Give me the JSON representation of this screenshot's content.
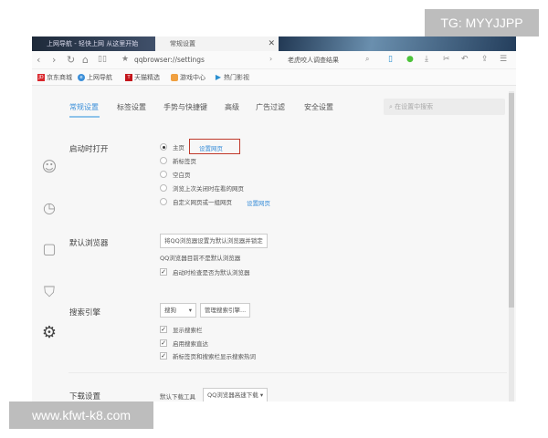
{
  "watermarks": {
    "top": "TG: MYYJJPP",
    "bottom": "www.kfwt-k8.com"
  },
  "tabs": [
    {
      "label": "上网导航 - 轻快上网 从这里开始"
    },
    {
      "label": "常规设置"
    }
  ],
  "toolbar": {
    "url": "qqbrowser://settings",
    "search_value": "老虎咬人调查结果"
  },
  "bookmarks": [
    {
      "label": "京东商城",
      "icon": "JD"
    },
    {
      "label": "上网导航",
      "icon": "e"
    },
    {
      "label": "天猫精选",
      "icon": "T"
    },
    {
      "label": "游戏中心",
      "icon": "game"
    },
    {
      "label": "热门影视",
      "icon": "play"
    }
  ],
  "settings_tabs": [
    "常规设置",
    "标签设置",
    "手势与快捷键",
    "高级",
    "广告过滤",
    "安全设置"
  ],
  "search_placeholder": "在设置中搜索",
  "startup": {
    "title": "启动时打开",
    "options": [
      "主页",
      "新标签页",
      "空白页",
      "浏览上次关闭时在看的网页",
      "自定义网页或一组网页"
    ],
    "selected": 0,
    "set_page_link": "设置网页"
  },
  "default_browser": {
    "title": "默认浏览器",
    "button": "将QQ浏览器设置为默认浏览器并锁定",
    "status": "QQ浏览器目前不是默认浏览器",
    "check_label": "启动时检查是否为默认浏览器"
  },
  "search_engine": {
    "title": "搜索引擎",
    "selected": "搜狗",
    "manage": "管理搜索引擎...",
    "checks": [
      "显示搜索栏",
      "启用搜索直达",
      "新标签页和搜索栏显示搜索热词"
    ]
  },
  "download": {
    "title": "下载设置",
    "label": "默认下载工具",
    "selected": "QQ浏览器高速下载"
  },
  "colors": {
    "accent": "#3b8fd9",
    "highlight": "#c0392b"
  }
}
